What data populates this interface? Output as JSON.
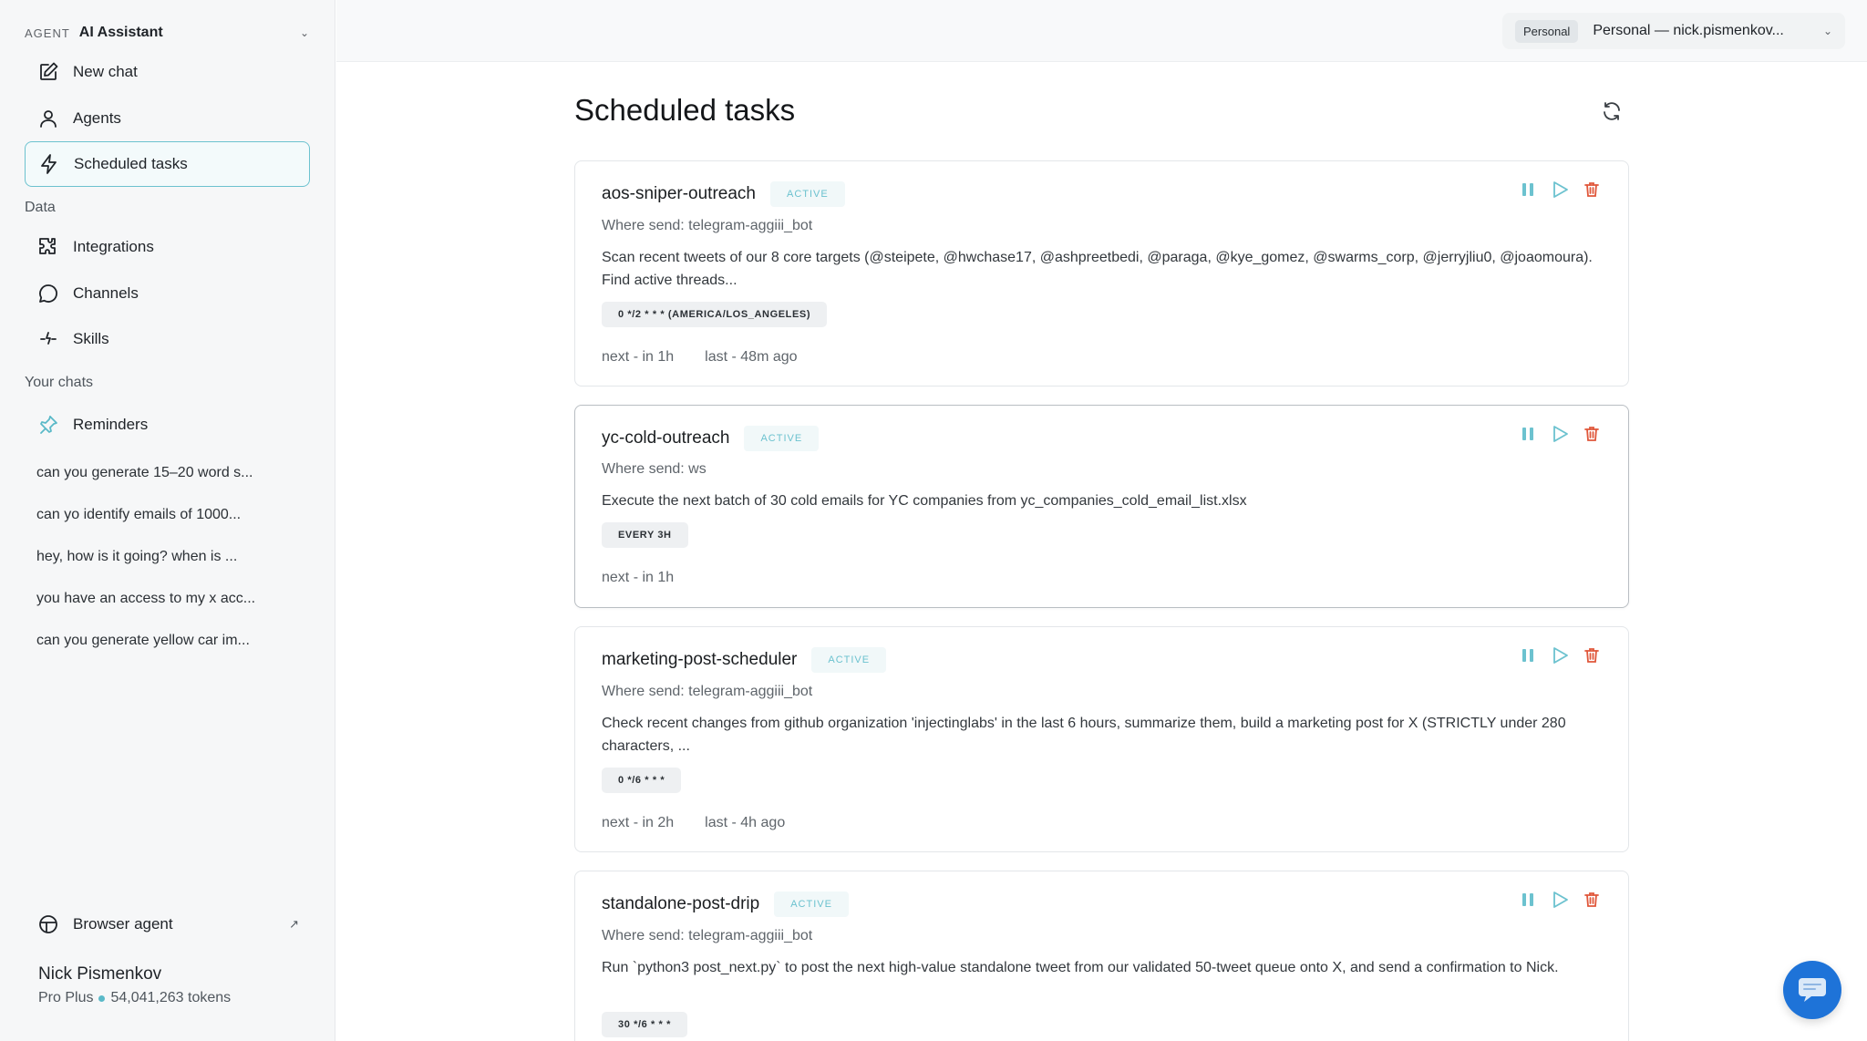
{
  "sidebar": {
    "agent_tag": "AGENT",
    "agent_name": "AI Assistant",
    "nav": [
      {
        "label": "New chat",
        "icon": "edit-icon"
      },
      {
        "label": "Agents",
        "icon": "user-icon"
      },
      {
        "label": "Scheduled tasks",
        "icon": "lightning-icon"
      }
    ],
    "data_label": "Data",
    "data_items": [
      {
        "label": "Integrations",
        "icon": "puzzle-icon"
      },
      {
        "label": "Channels",
        "icon": "chat-bubble-icon"
      },
      {
        "label": "Skills",
        "icon": "sparkle-icon"
      }
    ],
    "chats_label": "Your chats",
    "reminders_label": "Reminders",
    "chats": [
      "can you generate 15–20 word s...",
      "can yo identify emails of 1000...",
      "hey, how is it going? when is ...",
      "you have an access to my x acc...",
      "can you generate yellow car im..."
    ],
    "browser_agent": "Browser agent",
    "user_name": "Nick Pismenkov",
    "user_plan": "Pro Plus",
    "user_tokens": "54,041,263 tokens"
  },
  "topbar": {
    "workspace_pill": "Personal",
    "account_label": "Personal — nick.pismenkov..."
  },
  "page": {
    "title": "Scheduled tasks"
  },
  "tasks": [
    {
      "name": "aos-sniper-outreach",
      "status": "ACTIVE",
      "where": "Where send: telegram-aggiii_bot",
      "description": "Scan recent tweets of our 8 core targets (@steipete, @hwchase17, @ashpreetbedi, @paraga, @kye_gomez, @swarms_corp, @jerryjliu0, @joaomoura). Find active threads...",
      "schedule": "0 */2 * * * (AMERICA/LOS_ANGELES)",
      "next": "next - in 1h",
      "last": "last - 48m ago"
    },
    {
      "name": "yc-cold-outreach",
      "status": "ACTIVE",
      "where": "Where send: ws",
      "description": "Execute the next batch of 30 cold emails for YC companies from yc_companies_cold_email_list.xlsx",
      "schedule": "EVERY 3H",
      "next": "next - in 1h",
      "last": ""
    },
    {
      "name": "marketing-post-scheduler",
      "status": "ACTIVE",
      "where": "Where send: telegram-aggiii_bot",
      "description": "Check recent changes from github organization 'injectinglabs' in the last 6 hours, summarize them, build a marketing post for X (STRICTLY under 280 characters, ...",
      "schedule": "0 */6 * * *",
      "next": "next - in 2h",
      "last": "last - 4h ago"
    },
    {
      "name": "standalone-post-drip",
      "status": "ACTIVE",
      "where": "Where send: telegram-aggiii_bot",
      "description": "Run `python3 post_next.py` to post the next high-value standalone tweet from our validated 50-tweet queue onto X, and send a confirmation to Nick.",
      "schedule": "30 */6 * * *",
      "next": "",
      "last": ""
    }
  ],
  "colors": {
    "accent": "#6cc2cf",
    "danger": "#e0573b",
    "fab": "#1e73d8"
  }
}
